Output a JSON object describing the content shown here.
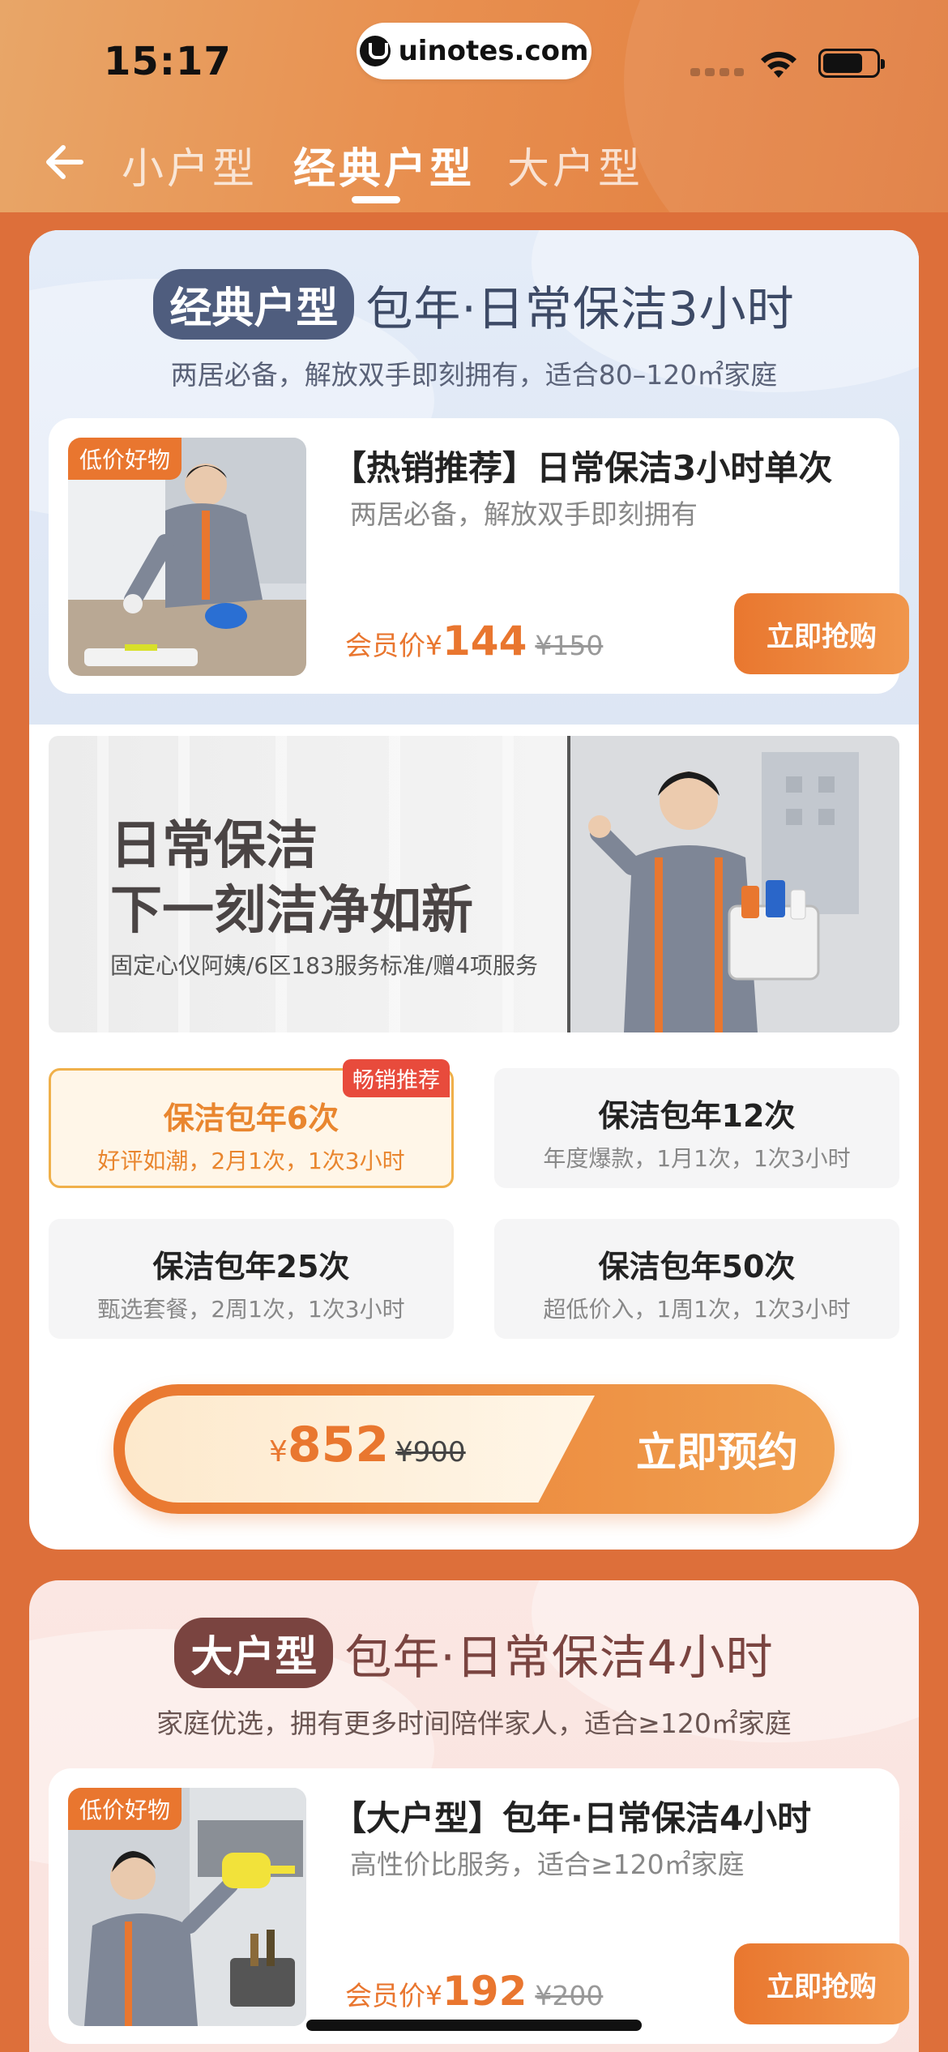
{
  "status_bar": {
    "time": "15:17",
    "url": "uinotes.com"
  },
  "nav": {
    "tabs": [
      {
        "label": "小户型",
        "active": false
      },
      {
        "label": "经典户型",
        "active": true
      },
      {
        "label": "大户型",
        "active": false
      }
    ]
  },
  "classic": {
    "badge": "经典户型",
    "title": "包年·日常保洁3小时",
    "subtitle": "两居必备，解放双手即刻拥有，适合80–120㎡家庭",
    "product": {
      "tag": "低价好物",
      "title": "【热销推荐】日常保洁3小时单次",
      "subtitle": "两居必备，解放双手即刻拥有",
      "price_label": "会员价",
      "currency": "¥",
      "price": "144",
      "old_price": "¥150",
      "buy_label": "立即抢购"
    },
    "banner": {
      "headline_1": "日常保洁",
      "headline_2": "下一刻洁净如新",
      "subline": "固定心仪阿姨/6区183服务标准/赠4项服务"
    },
    "options": [
      {
        "title": "保洁包年6次",
        "subtitle": "好评如潮，2月1次，1次3小时",
        "badge": "畅销推荐",
        "selected": true
      },
      {
        "title": "保洁包年12次",
        "subtitle": "年度爆款，1月1次，1次3小时",
        "selected": false
      },
      {
        "title": "保洁包年25次",
        "subtitle": "甄选套餐，2周1次，1次3小时",
        "selected": false
      },
      {
        "title": "保洁包年50次",
        "subtitle": "超低价入，1周1次，1次3小时",
        "selected": false
      }
    ],
    "reserve": {
      "currency": "¥",
      "price": "852",
      "old_price": "¥900",
      "button_label": "立即预约"
    }
  },
  "large": {
    "badge": "大户型",
    "title": "包年·日常保洁4小时",
    "subtitle": "家庭优选，拥有更多时间陪伴家人，适合≥120㎡家庭",
    "product": {
      "tag": "低价好物",
      "title": "【大户型】包年·日常保洁4小时",
      "subtitle": "高性价比服务，适合≥120㎡家庭",
      "price_label": "会员价",
      "currency": "¥",
      "price": "192",
      "old_price": "¥200",
      "buy_label": "立即抢购"
    }
  },
  "colors": {
    "accent": "#e9772f",
    "page_bg": "#dd6f3a",
    "classic_badge": "#4f5d7e",
    "large_badge": "#7a4440",
    "hot_badge": "#e84b3c"
  }
}
